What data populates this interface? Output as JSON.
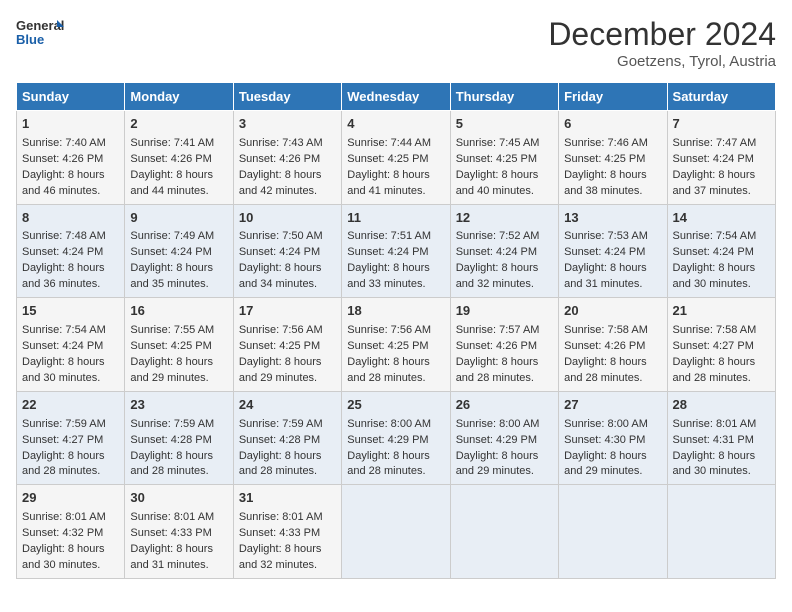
{
  "logo": {
    "line1": "General",
    "line2": "Blue"
  },
  "title": "December 2024",
  "subtitle": "Goetzens, Tyrol, Austria",
  "days_of_week": [
    "Sunday",
    "Monday",
    "Tuesday",
    "Wednesday",
    "Thursday",
    "Friday",
    "Saturday"
  ],
  "weeks": [
    [
      {
        "day": "1",
        "sunrise": "7:40 AM",
        "sunset": "4:26 PM",
        "daylight": "8 hours and 46 minutes."
      },
      {
        "day": "2",
        "sunrise": "7:41 AM",
        "sunset": "4:26 PM",
        "daylight": "8 hours and 44 minutes."
      },
      {
        "day": "3",
        "sunrise": "7:43 AM",
        "sunset": "4:26 PM",
        "daylight": "8 hours and 42 minutes."
      },
      {
        "day": "4",
        "sunrise": "7:44 AM",
        "sunset": "4:25 PM",
        "daylight": "8 hours and 41 minutes."
      },
      {
        "day": "5",
        "sunrise": "7:45 AM",
        "sunset": "4:25 PM",
        "daylight": "8 hours and 40 minutes."
      },
      {
        "day": "6",
        "sunrise": "7:46 AM",
        "sunset": "4:25 PM",
        "daylight": "8 hours and 38 minutes."
      },
      {
        "day": "7",
        "sunrise": "7:47 AM",
        "sunset": "4:24 PM",
        "daylight": "8 hours and 37 minutes."
      }
    ],
    [
      {
        "day": "8",
        "sunrise": "7:48 AM",
        "sunset": "4:24 PM",
        "daylight": "8 hours and 36 minutes."
      },
      {
        "day": "9",
        "sunrise": "7:49 AM",
        "sunset": "4:24 PM",
        "daylight": "8 hours and 35 minutes."
      },
      {
        "day": "10",
        "sunrise": "7:50 AM",
        "sunset": "4:24 PM",
        "daylight": "8 hours and 34 minutes."
      },
      {
        "day": "11",
        "sunrise": "7:51 AM",
        "sunset": "4:24 PM",
        "daylight": "8 hours and 33 minutes."
      },
      {
        "day": "12",
        "sunrise": "7:52 AM",
        "sunset": "4:24 PM",
        "daylight": "8 hours and 32 minutes."
      },
      {
        "day": "13",
        "sunrise": "7:53 AM",
        "sunset": "4:24 PM",
        "daylight": "8 hours and 31 minutes."
      },
      {
        "day": "14",
        "sunrise": "7:54 AM",
        "sunset": "4:24 PM",
        "daylight": "8 hours and 30 minutes."
      }
    ],
    [
      {
        "day": "15",
        "sunrise": "7:54 AM",
        "sunset": "4:24 PM",
        "daylight": "8 hours and 30 minutes."
      },
      {
        "day": "16",
        "sunrise": "7:55 AM",
        "sunset": "4:25 PM",
        "daylight": "8 hours and 29 minutes."
      },
      {
        "day": "17",
        "sunrise": "7:56 AM",
        "sunset": "4:25 PM",
        "daylight": "8 hours and 29 minutes."
      },
      {
        "day": "18",
        "sunrise": "7:56 AM",
        "sunset": "4:25 PM",
        "daylight": "8 hours and 28 minutes."
      },
      {
        "day": "19",
        "sunrise": "7:57 AM",
        "sunset": "4:26 PM",
        "daylight": "8 hours and 28 minutes."
      },
      {
        "day": "20",
        "sunrise": "7:58 AM",
        "sunset": "4:26 PM",
        "daylight": "8 hours and 28 minutes."
      },
      {
        "day": "21",
        "sunrise": "7:58 AM",
        "sunset": "4:27 PM",
        "daylight": "8 hours and 28 minutes."
      }
    ],
    [
      {
        "day": "22",
        "sunrise": "7:59 AM",
        "sunset": "4:27 PM",
        "daylight": "8 hours and 28 minutes."
      },
      {
        "day": "23",
        "sunrise": "7:59 AM",
        "sunset": "4:28 PM",
        "daylight": "8 hours and 28 minutes."
      },
      {
        "day": "24",
        "sunrise": "7:59 AM",
        "sunset": "4:28 PM",
        "daylight": "8 hours and 28 minutes."
      },
      {
        "day": "25",
        "sunrise": "8:00 AM",
        "sunset": "4:29 PM",
        "daylight": "8 hours and 28 minutes."
      },
      {
        "day": "26",
        "sunrise": "8:00 AM",
        "sunset": "4:29 PM",
        "daylight": "8 hours and 29 minutes."
      },
      {
        "day": "27",
        "sunrise": "8:00 AM",
        "sunset": "4:30 PM",
        "daylight": "8 hours and 29 minutes."
      },
      {
        "day": "28",
        "sunrise": "8:01 AM",
        "sunset": "4:31 PM",
        "daylight": "8 hours and 30 minutes."
      }
    ],
    [
      {
        "day": "29",
        "sunrise": "8:01 AM",
        "sunset": "4:32 PM",
        "daylight": "8 hours and 30 minutes."
      },
      {
        "day": "30",
        "sunrise": "8:01 AM",
        "sunset": "4:33 PM",
        "daylight": "8 hours and 31 minutes."
      },
      {
        "day": "31",
        "sunrise": "8:01 AM",
        "sunset": "4:33 PM",
        "daylight": "8 hours and 32 minutes."
      },
      null,
      null,
      null,
      null
    ]
  ],
  "labels": {
    "sunrise": "Sunrise: ",
    "sunset": "Sunset: ",
    "daylight": "Daylight: "
  }
}
